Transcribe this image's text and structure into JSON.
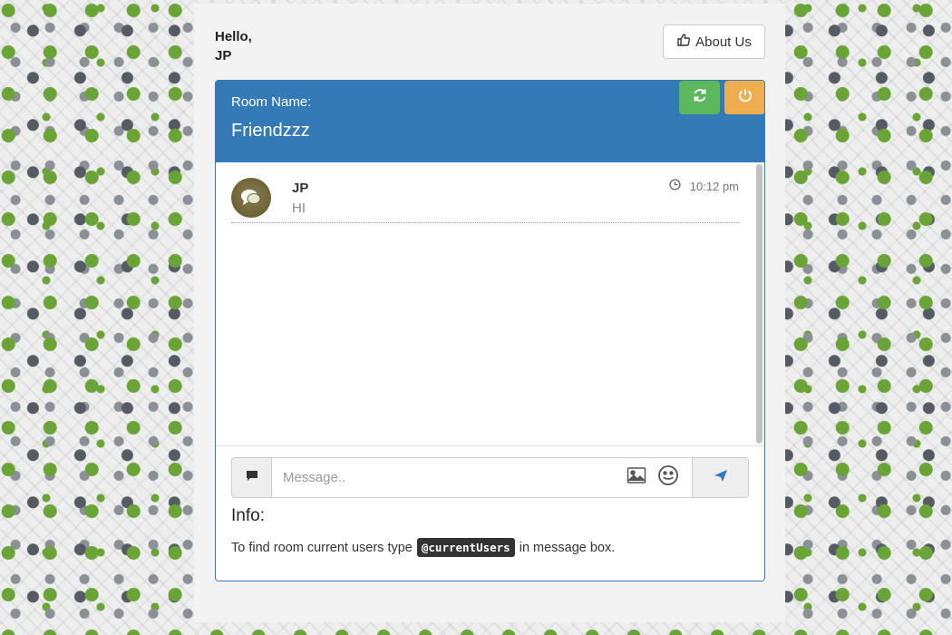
{
  "header": {
    "greeting_line1": "Hello,",
    "greeting_line2": "JP",
    "about_label": "About Us",
    "about_icon": "thumbs-up-icon"
  },
  "room": {
    "label": "Room Name:",
    "name": "Friendzzz",
    "refresh_icon": "refresh-icon",
    "power_icon": "power-icon"
  },
  "messages": [
    {
      "sender": "JP",
      "text": "HI",
      "time": "10:12 pm"
    }
  ],
  "composer": {
    "placeholder": "Message..",
    "value": ""
  },
  "info": {
    "title": "Info:",
    "text_before": "To find room current users type",
    "code": "@currentUsers",
    "text_after": "in message box."
  },
  "colors": {
    "primary": "#337ab7",
    "success": "#5cb85c",
    "warning": "#f0ad4e"
  }
}
